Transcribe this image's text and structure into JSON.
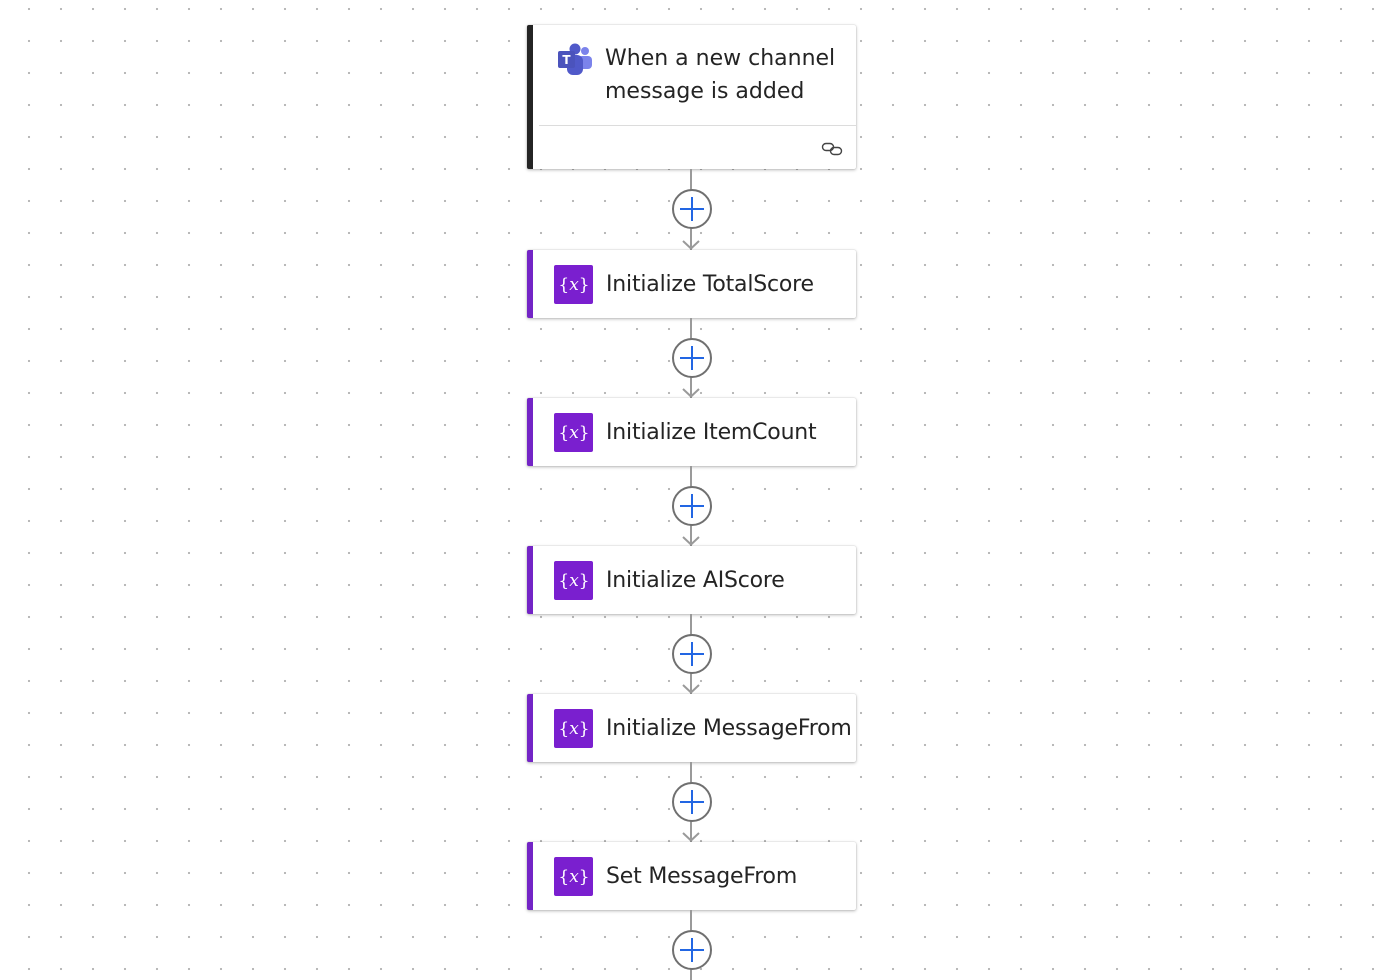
{
  "flow": {
    "trigger": {
      "title": "When a new channel message is added",
      "icon": "microsoft-teams-icon",
      "footer_icon": "link-icon"
    },
    "actions": [
      {
        "label": "Initialize TotalScore",
        "icon": "variable-icon"
      },
      {
        "label": "Initialize ItemCount",
        "icon": "variable-icon"
      },
      {
        "label": "Initialize AIScore",
        "icon": "variable-icon"
      },
      {
        "label": "Initialize MessageFrom",
        "icon": "variable-icon"
      },
      {
        "label": "Set MessageFrom",
        "icon": "variable-icon"
      }
    ],
    "add_step_icon": "plus-icon",
    "colors": {
      "trigger_accent": "#242424",
      "variable_accent": "#7324c6",
      "variable_icon_bg": "#7a1fcf",
      "plus": "#2266e3",
      "connector": "#9a9a9a"
    }
  }
}
